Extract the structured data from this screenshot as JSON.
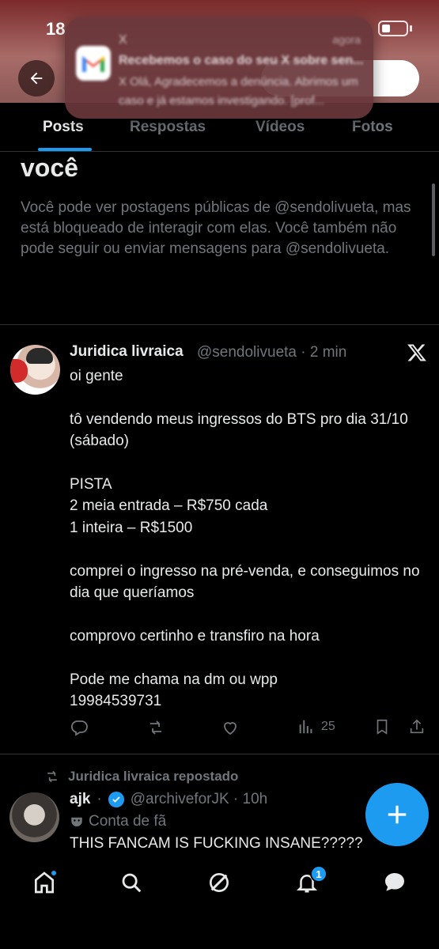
{
  "status_bar": {
    "time": "18"
  },
  "notification": {
    "app_icon": "gmail-icon",
    "sender": "X",
    "time": "agora",
    "subject": "Recebemos o caso do seu X sobre sen...",
    "body": "X Olá, Agradecemos a denúncia. Abrimos um caso e já estamos investigando. [prof..."
  },
  "header": {
    "back_icon": "arrow-left-icon"
  },
  "tabs": [
    {
      "label": "Posts",
      "active": true
    },
    {
      "label": "Respostas",
      "active": false
    },
    {
      "label": "Vídeos",
      "active": false
    },
    {
      "label": "Fotos",
      "active": false
    }
  ],
  "blocked": {
    "title": "você",
    "text": "Você pode ver postagens públicas de @sendolivueta, mas está bloqueado de interagir com elas. Você também não pode seguir ou enviar mensagens para @sendolivueta."
  },
  "post": {
    "author": "Juridica livraica",
    "handle_time": "@sendolivueta · 2 min",
    "text": "oi gente\n\ntô vendendo meus ingressos do BTS pro dia 31/10 (sábado)\n\nPISTA\n2 meia entrada – R$750 cada\n1 inteira – R$1500\n\ncomprei o ingresso na pré-venda, e conseguimos no dia que queríamos\n\ncomprovo certinho e transfiro na hora\n\nPode me chama na dm ou wpp\n19984539731",
    "views": "25"
  },
  "repost": {
    "label": "Juridica livraica repostado",
    "author": "ajk",
    "handle_time": "@archiveforJK · 10h",
    "fan_label": "Conta de fã",
    "text": "THIS FANCAM IS FUCKING INSANE?????"
  },
  "nav": {
    "notifications_badge": "1"
  },
  "colors": {
    "accent": "#1d9bf0",
    "background": "#000000",
    "muted": "#71767b",
    "text": "#e7e9ea"
  }
}
